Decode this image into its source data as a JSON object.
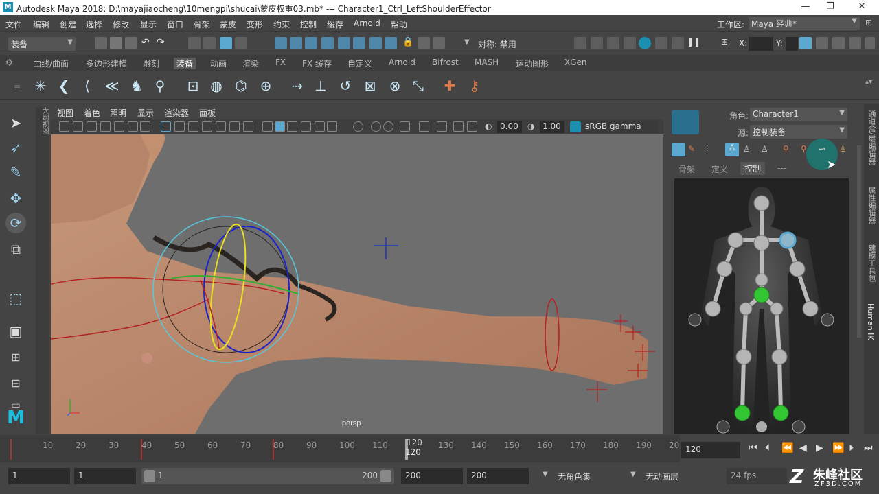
{
  "window": {
    "title": "Autodesk Maya 2018: D:\\mayajiaocheng\\10mengpi\\shucai\\蒙皮权重03.mb*   ---   Character1_Ctrl_LeftShoulderEffector",
    "minimize": "—",
    "restore": "❐",
    "close": "✕"
  },
  "menubar": {
    "items": [
      "文件",
      "编辑",
      "创建",
      "选择",
      "修改",
      "显示",
      "窗口",
      "骨架",
      "蒙皮",
      "变形",
      "约束",
      "控制",
      "缓存",
      "Arnold",
      "帮助"
    ],
    "workspace_label": "工作区:",
    "workspace_value": "Maya 经典*"
  },
  "statusline": {
    "mode": "装备",
    "symmetry": "对称: 禁用",
    "x_label": "X:",
    "y_label": "Y:"
  },
  "shelf_tabs": [
    "曲线/曲面",
    "多边形建模",
    "雕刻",
    "装备",
    "动画",
    "渲染",
    "FX",
    "FX 缓存",
    "自定义",
    "Arnold",
    "Bifrost",
    "MASH",
    "运动图形",
    "XGen"
  ],
  "shelf_active": "装备",
  "outliner_tab": "大纲视图",
  "panel": {
    "menus": [
      "视图",
      "着色",
      "照明",
      "显示",
      "渲染器",
      "面板"
    ],
    "exposure": "0.00",
    "gamma": "1.00",
    "colorspace": "sRGB gamma",
    "camera_label": "persp"
  },
  "hik": {
    "character_label": "角色:",
    "character_value": "Character1",
    "source_label": "源:",
    "source_value": "控制装备",
    "tabs": [
      "骨架",
      "定义",
      "控制",
      "---"
    ],
    "active_tab": "控制"
  },
  "right_tabs": [
    "通道盒/层编辑器",
    "属性编辑器",
    "建模工具包",
    "Human IK"
  ],
  "timeslider": {
    "ticks": [
      "10",
      "20",
      "30",
      "40",
      "50",
      "60",
      "70",
      "80",
      "90",
      "100",
      "110",
      "120",
      "130",
      "140",
      "150",
      "160",
      "170",
      "180",
      "190",
      "20"
    ],
    "current_frame_label": "120",
    "current_frame_field": "120"
  },
  "range": {
    "start": "1",
    "playback_start": "1",
    "slider_start": "1",
    "slider_end": "200",
    "playback_end": "200",
    "end": "200",
    "char_set": "无角色集",
    "anim_layer": "无动画层",
    "fps": "24 fps"
  },
  "watermark": "朱峰社区",
  "watermark_url": "ZF3D.COM",
  "colors": {
    "accent": "#5ba8d0",
    "maya_blue": "#1a8fb0",
    "hik_green": "#33c633"
  }
}
